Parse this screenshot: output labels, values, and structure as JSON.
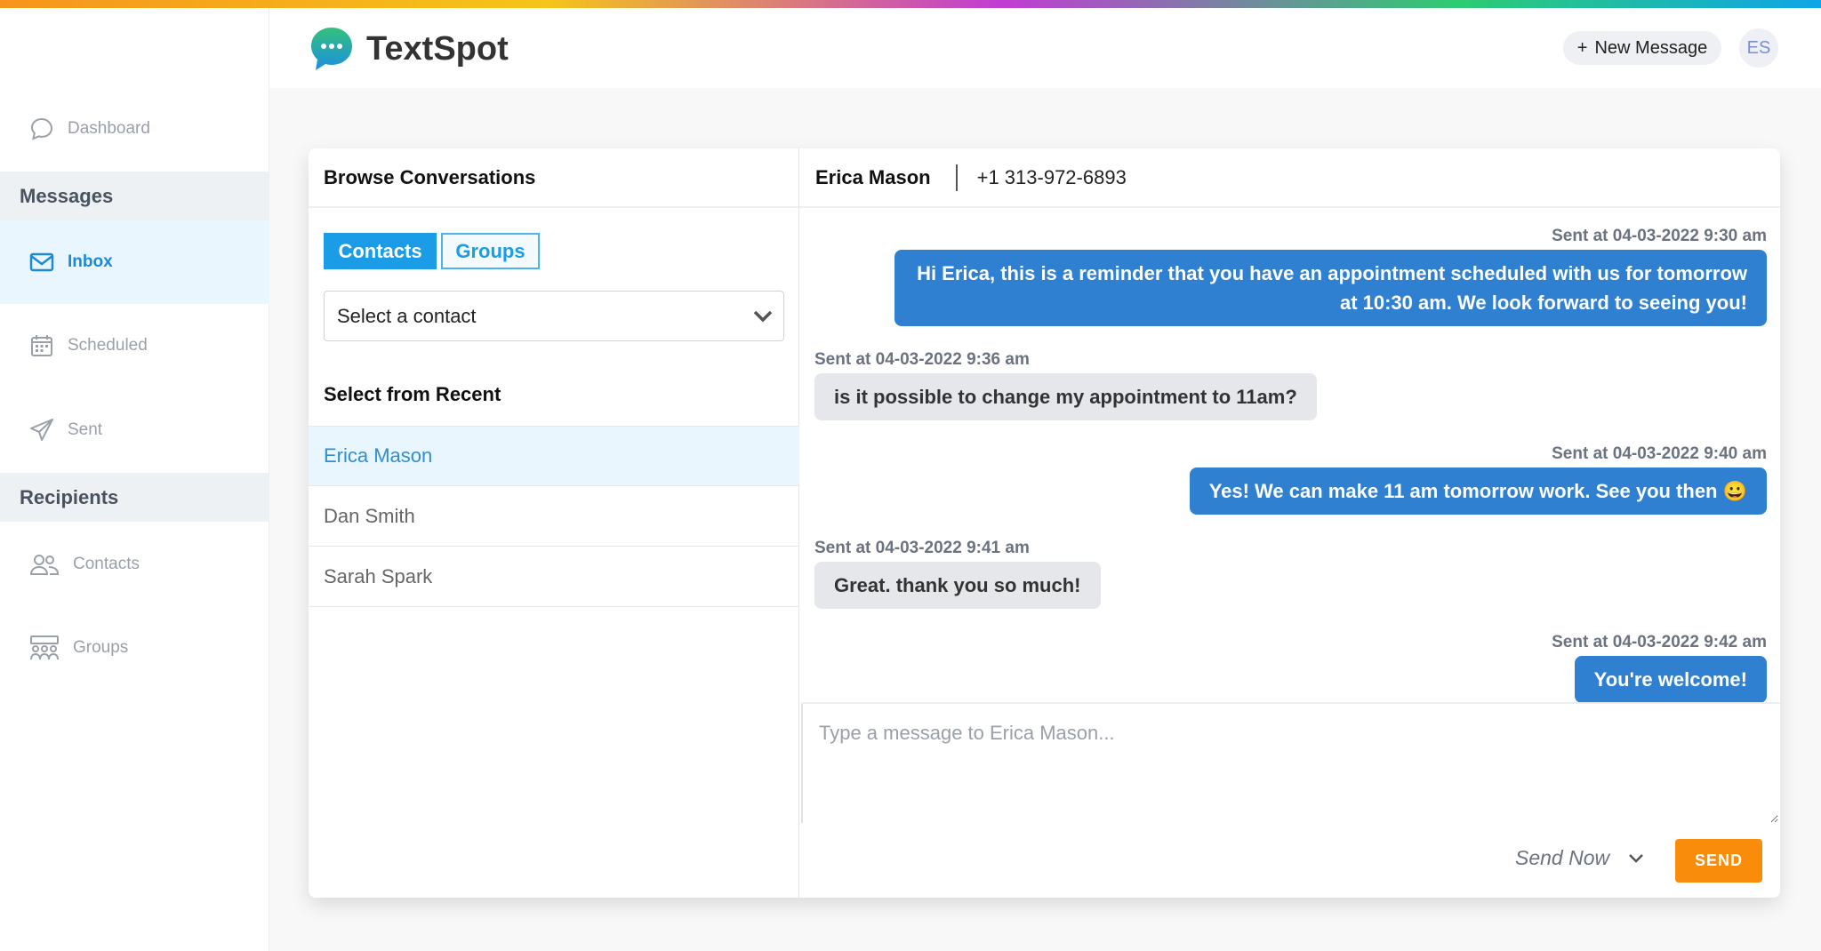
{
  "app": {
    "name": "TextSpot",
    "brand_colors": {
      "primary": "#1a9de6",
      "bubble": "#2f80d1",
      "send": "#f98c0a"
    }
  },
  "header": {
    "new_message_label": "New Message",
    "new_message_icon": "plus-icon",
    "avatar_initials": "ES"
  },
  "sidebar": {
    "dashboard": "Dashboard",
    "messages_section": "Messages",
    "inbox": "Inbox",
    "scheduled": "Scheduled",
    "sent": "Sent",
    "recipients_section": "Recipients",
    "contacts": "Contacts",
    "groups": "Groups"
  },
  "browse": {
    "title": "Browse Conversations",
    "tabs": [
      "Contacts",
      "Groups"
    ],
    "select_placeholder": "Select a contact",
    "recent_title": "Select from Recent",
    "recent": [
      "Erica Mason",
      "Dan Smith",
      "Sarah Spark"
    ]
  },
  "chat": {
    "name": "Erica Mason",
    "phone": "+1 313-972-6893",
    "messages": [
      {
        "dir": "out",
        "time": "Sent at 04-03-2022 9:30 am",
        "text": "Hi Erica, this is a reminder that you have an appointment scheduled with us for tomorrow at 10:30 am. We look forward to seeing you!"
      },
      {
        "dir": "in",
        "time": "Sent at 04-03-2022 9:36 am",
        "text": "is it possible to change my appointment to 11am?"
      },
      {
        "dir": "out",
        "time": "Sent at 04-03-2022 9:40 am",
        "text": "Yes! We can make 11 am tomorrow work. See you then 😀"
      },
      {
        "dir": "in",
        "time": "Sent at 04-03-2022 9:41 am",
        "text": "Great. thank you so much!"
      },
      {
        "dir": "out",
        "time": "Sent at 04-03-2022 9:42 am",
        "text": "You're welcome!"
      }
    ],
    "composer_placeholder": "Type a message to Erica Mason...",
    "send_mode": "Send Now",
    "send_label": "SEND"
  }
}
